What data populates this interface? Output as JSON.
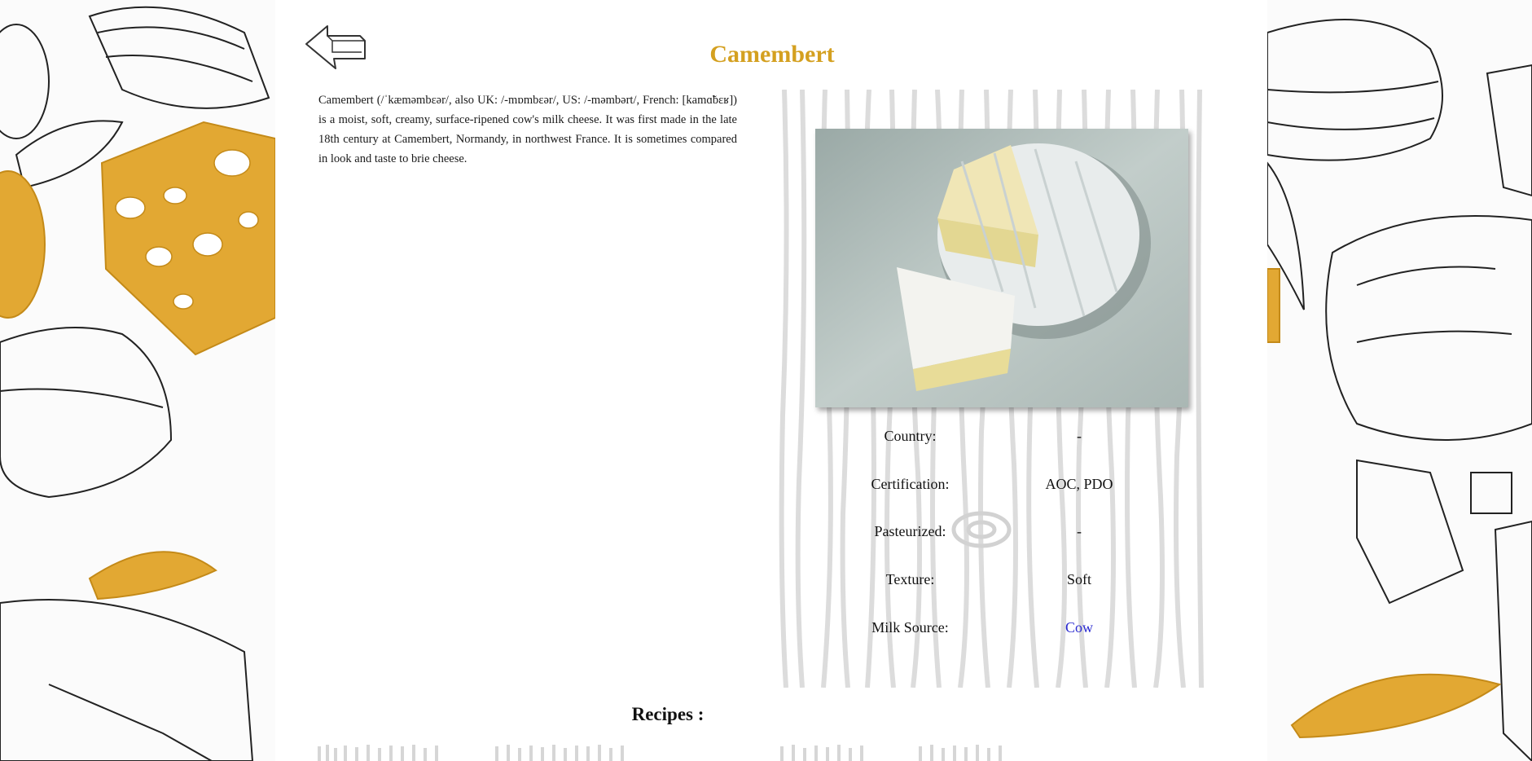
{
  "page": {
    "title": "Camembert",
    "description": "Camembert (/ˈkæməmbɛər/, also UK: /-mɒmbɛər/, US: /-məmbərt/, French: [kamɑ̃bɛʁ]) is a moist, soft, creamy, surface-ripened cow's milk cheese. It was first made in the late 18th century at Camembert, Normandy, in northwest France. It is sometimes compared in look and taste to brie cheese."
  },
  "info": {
    "rows": [
      {
        "label": "Country:",
        "value": "-"
      },
      {
        "label": "Certification:",
        "value": "AOC, PDO"
      },
      {
        "label": "Pasteurized:",
        "value": "-"
      },
      {
        "label": "Texture:",
        "value": "Soft"
      },
      {
        "label": "Milk Source:",
        "value": "Cow"
      }
    ]
  },
  "recipes": {
    "heading": "Recipes :"
  },
  "icons": {
    "back": "back-arrow-icon",
    "photo": "camembert-photo"
  },
  "colors": {
    "title": "#d4a020",
    "link": "#2a2ad0",
    "accent_illustration": "#e0a830",
    "wood": "#d9d9d9"
  }
}
